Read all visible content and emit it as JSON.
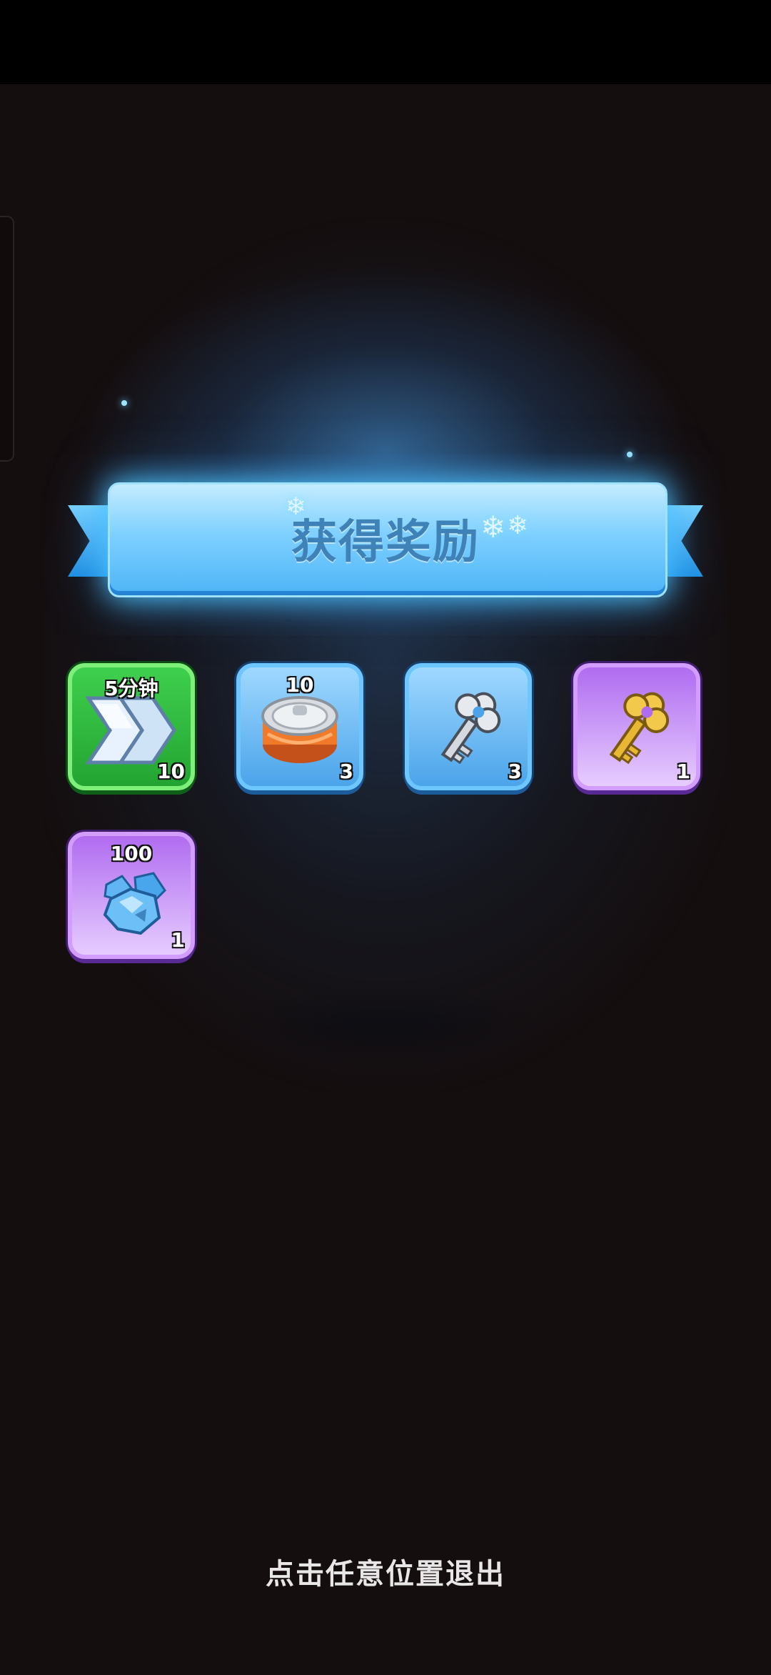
{
  "banner": {
    "title": "获得奖励"
  },
  "rewards": [
    {
      "top_label": "5分钟",
      "count": "10",
      "icon": "speedup-arrows-icon",
      "rarity": "green"
    },
    {
      "top_label": "10",
      "count": "3",
      "icon": "food-can-icon",
      "rarity": "blue"
    },
    {
      "top_label": "",
      "count": "3",
      "icon": "silver-key-icon",
      "rarity": "blue"
    },
    {
      "top_label": "",
      "count": "1",
      "icon": "gold-key-icon",
      "rarity": "purple"
    },
    {
      "top_label": "100",
      "count": "1",
      "icon": "blue-gems-icon",
      "rarity": "purple"
    }
  ],
  "footer": {
    "hint": "点击任意位置退出"
  },
  "colors": {
    "background": "#150e0f",
    "banner": "#7ed0ff",
    "banner_text": "#3f82b8",
    "tile_green": "#23a432",
    "tile_blue": "#4ba4ea",
    "tile_purple": "#b06cf0"
  }
}
